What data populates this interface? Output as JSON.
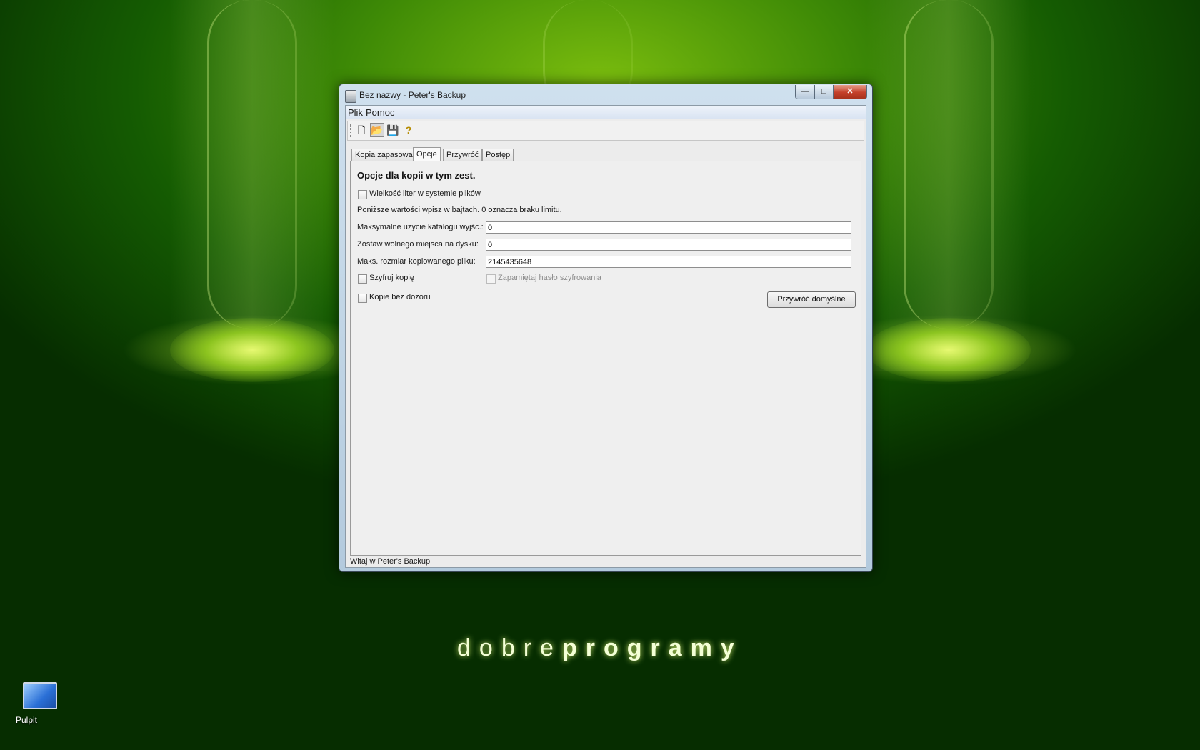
{
  "desktop": {
    "brand_light": "dobre",
    "brand_bold": "programy",
    "icon_label": "Pulpit"
  },
  "window": {
    "title": "Bez nazwy - Peter's Backup",
    "controls": {
      "minimize": "—",
      "maximize": "□",
      "close": "✕"
    },
    "menu": [
      "Plik",
      "Pomoc"
    ],
    "toolbar": [
      {
        "icon": "new-file-icon",
        "glyph": "🗋"
      },
      {
        "icon": "open-folder-icon",
        "glyph": "📂"
      },
      {
        "icon": "save-icon",
        "glyph": "💾"
      },
      {
        "icon": "help-icon",
        "glyph": "?"
      }
    ],
    "tabs": [
      "Kopia zapasowa",
      "Opcje",
      "Przywróć",
      "Postęp"
    ],
    "active_tab": "Opcje",
    "options": {
      "heading": "Opcje dla kopii w tym zest.",
      "case_sensitive_label": "Wielkość liter w systemie plików",
      "bytes_note": "Poniższe wartości wpisz w bajtach. 0 oznacza braku limitu.",
      "max_usage_label": "Maksymalne użycie katalogu wyjśc.:",
      "max_usage_value": "0",
      "free_space_label": "Zostaw wolnego miejsca na dysku:",
      "free_space_value": "0",
      "max_file_label": "Maks. rozmiar kopiowanego pliku:",
      "max_file_value": "2145435648",
      "encrypt_label": "Szyfruj kopię",
      "remember_password_label": "Zapamiętaj hasło szyfrowania",
      "unattended_label": "Kopie bez dozoru",
      "restore_defaults_label": "Przywróć domyślne"
    },
    "status_text": "Witaj w Peter's Backup"
  }
}
